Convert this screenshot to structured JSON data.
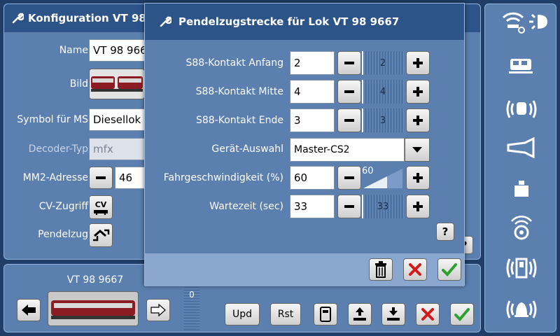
{
  "background_panel": {
    "title": "Konfiguration VT 98",
    "labels": {
      "name": "Name",
      "bild": "Bild",
      "symbol": "Symbol für MS",
      "decoder": "Decoder-Typ",
      "mm2": "MM2-Adresse",
      "cv": "CV-Zugriff",
      "pendelzug": "Pendelzug"
    },
    "values": {
      "name": "VT 98 966",
      "symbol": "Diesellok",
      "decoder": "mfx",
      "mm2": "46"
    },
    "cv_button": "CV"
  },
  "bottom_panel": {
    "loco_name": "VT 98 9667",
    "counter": "0",
    "upd_label": "Upd",
    "rst_label": "Rst"
  },
  "dialog": {
    "title": "Pendelzugstrecke für Lok VT 98 9667",
    "rows": [
      {
        "label": "S88-Kontakt Anfang",
        "value": "2",
        "slider": "2"
      },
      {
        "label": "S88-Kontakt Mitte",
        "value": "4",
        "slider": "4"
      },
      {
        "label": "S88-Kontakt Ende",
        "value": "3",
        "slider": "3"
      },
      {
        "label": "Geschwindigkeit",
        "value": "60",
        "slider": "60"
      },
      {
        "label": "Wartezeit (sec)",
        "value": "33",
        "slider": "33"
      }
    ],
    "device_label": "Gerät-Auswahl",
    "device_value": "Master-CS2",
    "speed_label": "Fahrgeschwindigkeit (%)",
    "help": "?"
  },
  "colors": {
    "panel": "#5b7fae",
    "titlebar": "#2c5489",
    "background": "#1f3d66",
    "confirm": "#2ea02e",
    "cancel": "#d21a1a"
  },
  "sidebar_icons": [
    "wifi-icon",
    "light-icon",
    "loco-icon",
    "sound-icon",
    "horn-icon",
    "weight-icon",
    "radio-icon",
    "door-icon",
    "bell-icon"
  ]
}
